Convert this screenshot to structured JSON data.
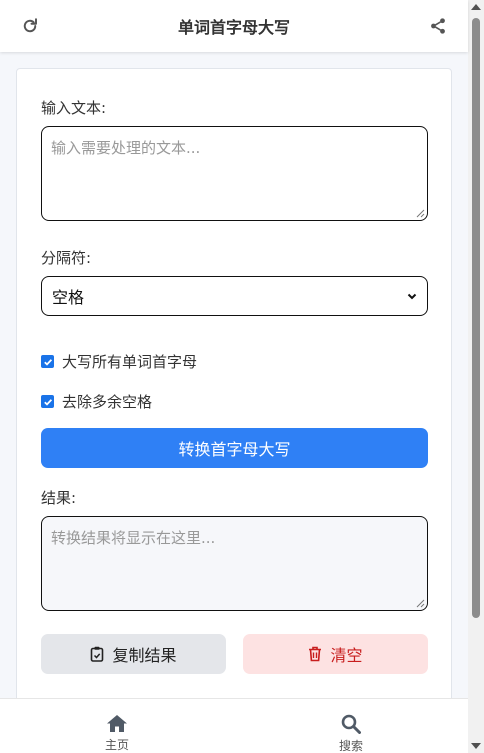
{
  "header": {
    "title": "单词首字母大写"
  },
  "form": {
    "input_label": "输入文本:",
    "input_placeholder": "输入需要处理的文本...",
    "input_value": "",
    "separator_label": "分隔符:",
    "separator_selected": "空格",
    "checkbox_capitalize_all": {
      "label": "大写所有单词首字母",
      "checked": true
    },
    "checkbox_remove_spaces": {
      "label": "去除多余空格",
      "checked": true
    },
    "convert_button": "转换首字母大写",
    "result_label": "结果:",
    "result_placeholder": "转换结果将显示在这里...",
    "result_value": "",
    "copy_button": "复制结果",
    "clear_button": "清空"
  },
  "bottom_nav": {
    "items": [
      {
        "label": "主页",
        "icon": "home-icon"
      },
      {
        "label": "搜索",
        "icon": "search-icon"
      }
    ]
  },
  "colors": {
    "primary": "#2f80f5",
    "danger": "#c81e1e",
    "danger_bg": "#fde2e2",
    "neutral_bg": "#e4e6ea",
    "checkbox": "#1a73e8"
  }
}
